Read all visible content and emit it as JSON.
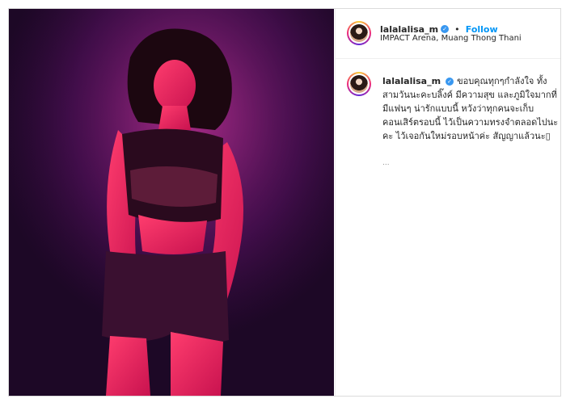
{
  "post": {
    "username": "lalalalisa_m",
    "verified_icon": "verified-badge-icon",
    "follow_label": "Follow",
    "separator": "•",
    "location": "IMPACT Arena, Muang Thong Thani",
    "caption_username": "lalalalisa_m",
    "caption_text": "ขอบคุณทุกๆกำลังใจ ทั้งสามวันนะคะบลิ๊งค์ มีความสุข และภูมิใจมากที่มีแฟนๆ น่ารักแบบนี้ หวังว่าทุกคนจะเก็บคอนเสิร์ตรอบนี้ ไว้เป็นความทรงจำตลอดไปนะคะ ไว้เจอกันใหม่รอบหน้าค่ะ สัญญาแล้วนะ▯",
    "meta_text": "...",
    "colors": {
      "accent": "#0095f6",
      "verified": "#3897f0",
      "stage_light": "#e0307a"
    }
  }
}
